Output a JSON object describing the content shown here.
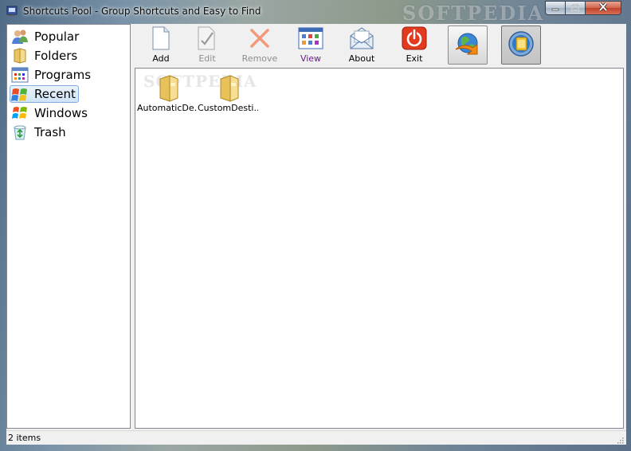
{
  "window": {
    "title": "Shortcuts Pool - Group Shortcuts and Easy to Find",
    "watermark": "SOFTPEDIA",
    "controls": {
      "minimize_icon": "minimize-icon",
      "maximize_icon": "maximize-icon",
      "close_icon": "close-icon"
    }
  },
  "sidebar": {
    "selected": "Recent",
    "items": [
      {
        "label": "Popular",
        "icon": "people-icon"
      },
      {
        "label": "Folders",
        "icon": "folder-icon"
      },
      {
        "label": "Programs",
        "icon": "programs-icon"
      },
      {
        "label": "Recent",
        "icon": "recent-icon"
      },
      {
        "label": "Windows",
        "icon": "windows-flag-icon"
      },
      {
        "label": "Trash",
        "icon": "recycle-bin-icon"
      }
    ]
  },
  "toolbar": {
    "buttons": [
      {
        "label": "Add",
        "icon": "new-document-icon",
        "enabled": true
      },
      {
        "label": "Edit",
        "icon": "edit-document-icon",
        "enabled": false
      },
      {
        "label": "Remove",
        "icon": "remove-x-icon",
        "enabled": false
      },
      {
        "label": "View",
        "icon": "view-grid-icon",
        "enabled": true
      },
      {
        "label": "About",
        "icon": "envelope-icon",
        "enabled": true
      },
      {
        "label": "Exit",
        "icon": "power-icon",
        "enabled": true
      }
    ],
    "square_buttons": [
      {
        "icon": "globe-shortcut-icon",
        "pressed": false
      },
      {
        "icon": "lock-circle-icon",
        "pressed": true
      }
    ]
  },
  "content": {
    "watermark": "SOFTPEDIA",
    "files": [
      {
        "name": "AutomaticDe...",
        "icon": "folder-icon"
      },
      {
        "name": "CustomDesti...",
        "icon": "folder-icon"
      }
    ]
  },
  "status": {
    "text": "2 items"
  },
  "colors": {
    "selection_bg": "#d0e4f8",
    "selection_border": "#84acdd",
    "view_label": "#6b1c8c",
    "close_red": "#c0402a"
  }
}
